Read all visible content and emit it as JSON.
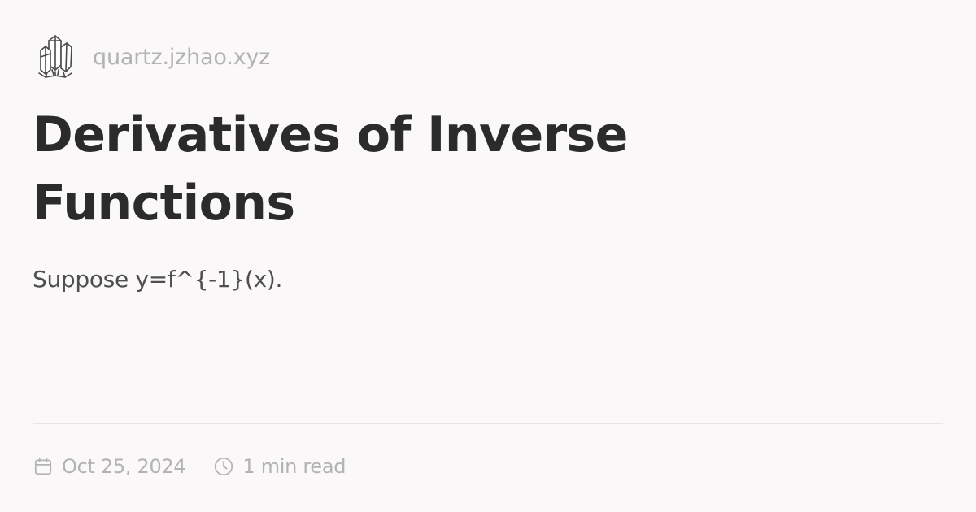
{
  "site": {
    "logo_icon": "crystal-logo-icon",
    "name": "quartz.jzhao.xyz"
  },
  "article": {
    "title": "Derivatives of Inverse Functions",
    "description": "Suppose y=f^{-1}(x)."
  },
  "meta": {
    "date_icon": "calendar-icon",
    "date": "Oct 25, 2024",
    "reading_time_icon": "clock-icon",
    "reading_time": "1 min read"
  },
  "colors": {
    "background": "#faf8f8",
    "title": "#2b2b2b",
    "body_text": "#4e4e4e",
    "muted_text": "#b3b3b3",
    "divider": "#e6e4e4"
  }
}
